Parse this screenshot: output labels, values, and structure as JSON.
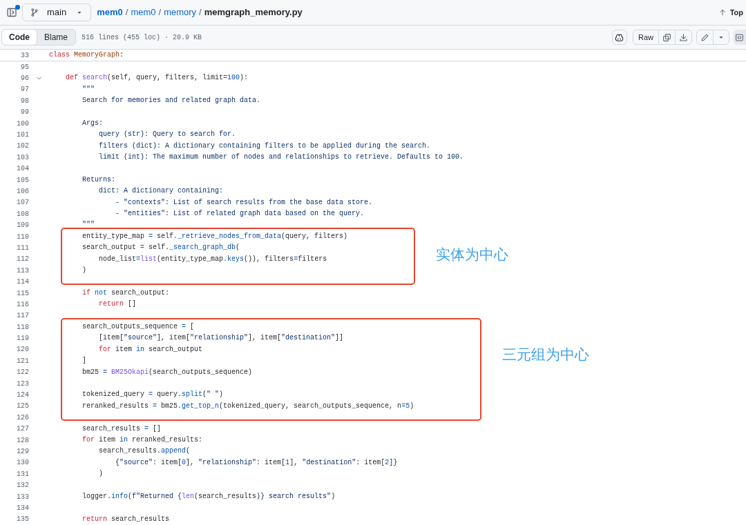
{
  "top_bar": {
    "sidebar_notification": true,
    "branch": "main",
    "breadcrumb": [
      {
        "kind": "repo",
        "text": "mem0"
      },
      {
        "kind": "separator",
        "text": "/"
      },
      {
        "kind": "dir",
        "text": "mem0"
      },
      {
        "kind": "separator",
        "text": "/"
      },
      {
        "kind": "dir",
        "text": "memory"
      },
      {
        "kind": "separator",
        "text": "/"
      },
      {
        "kind": "file",
        "text": "memgraph_memory.py"
      }
    ],
    "top_link": "Top"
  },
  "file_bar": {
    "tabs": [
      {
        "label": "Code",
        "selected": true
      },
      {
        "label": "Blame",
        "selected": false
      }
    ],
    "info": "516 lines (455 loc) · 20.9 KB",
    "raw_label": "Raw"
  },
  "pinned_line": {
    "number": "33",
    "segments": [
      {
        "kind": "keyword",
        "text": "class"
      },
      {
        "kind": "classname",
        "text": " MemoryGraph"
      },
      {
        "kind": "plain",
        "text": ":"
      }
    ]
  },
  "blocks": [
    {
      "kind": "plain",
      "lines": [
        {
          "number": "95"
        },
        {
          "number": "96",
          "expanded": true,
          "segments": [
            {
              "kind": "keyword",
              "text": "    def"
            },
            {
              "kind": "func",
              "text": " search"
            },
            {
              "kind": "plain",
              "text": "(self, query, filters, limit"
            },
            {
              "kind": "operator",
              "text": "="
            },
            {
              "kind": "number",
              "text": "100"
            },
            {
              "kind": "plain",
              "text": "):"
            }
          ]
        },
        {
          "number": "97",
          "segments": [
            {
              "kind": "string",
              "text": "        \"\"\""
            }
          ]
        },
        {
          "number": "98",
          "segments": [
            {
              "kind": "string",
              "text": "        Search for memories and related graph data."
            }
          ]
        },
        {
          "number": "99"
        },
        {
          "number": "100",
          "segments": [
            {
              "kind": "string",
              "text": "        Args:"
            }
          ]
        },
        {
          "number": "101",
          "segments": [
            {
              "kind": "string",
              "text": "            query (str): Query to search for."
            }
          ]
        },
        {
          "number": "102",
          "segments": [
            {
              "kind": "string",
              "text": "            filters (dict): A dictionary containing filters to be applied during the search."
            }
          ]
        },
        {
          "number": "103",
          "segments": [
            {
              "kind": "string",
              "text": "            limit (int): The maximum number of nodes and relationships to retrieve. Defaults to 100."
            }
          ]
        },
        {
          "number": "104"
        },
        {
          "number": "105",
          "segments": [
            {
              "kind": "string",
              "text": "        Returns:"
            }
          ]
        },
        {
          "number": "106",
          "segments": [
            {
              "kind": "string",
              "text": "            dict: A dictionary containing:"
            }
          ]
        },
        {
          "number": "107",
          "segments": [
            {
              "kind": "string",
              "text": "                - \"contexts\": List of search results from the base data store."
            }
          ]
        },
        {
          "number": "108",
          "segments": [
            {
              "kind": "string",
              "text": "                - \"entities\": List of related graph data based on the query."
            }
          ]
        },
        {
          "number": "109",
          "segments": [
            {
              "kind": "string",
              "text": "        \"\"\""
            }
          ]
        }
      ]
    },
    {
      "kind": "highlight",
      "label": "实体为中心",
      "lines": [
        {
          "number": "110",
          "segments": [
            {
              "kind": "plain",
              "text": "        entity_type_map "
            },
            {
              "kind": "operator",
              "text": "="
            },
            {
              "kind": "plain",
              "text": " self."
            },
            {
              "kind": "name",
              "text": "_retrieve_nodes_from_data"
            },
            {
              "kind": "plain",
              "text": "(query, filters)"
            }
          ]
        },
        {
          "number": "111",
          "segments": [
            {
              "kind": "plain",
              "text": "        search_output "
            },
            {
              "kind": "operator",
              "text": "="
            },
            {
              "kind": "plain",
              "text": " self."
            },
            {
              "kind": "name",
              "text": "_search_graph_db"
            },
            {
              "kind": "plain",
              "text": "("
            }
          ]
        },
        {
          "number": "112",
          "segments": [
            {
              "kind": "plain",
              "text": "            node_list"
            },
            {
              "kind": "operator",
              "text": "="
            },
            {
              "kind": "func",
              "text": "list"
            },
            {
              "kind": "plain",
              "text": "(entity_type_map."
            },
            {
              "kind": "name",
              "text": "keys"
            },
            {
              "kind": "plain",
              "text": "()), filters"
            },
            {
              "kind": "operator",
              "text": "="
            },
            {
              "kind": "plain",
              "text": "filters"
            }
          ]
        },
        {
          "number": "113",
          "segments": [
            {
              "kind": "plain",
              "text": "        )"
            }
          ]
        },
        {
          "number": "114"
        }
      ]
    },
    {
      "kind": "plain",
      "lines": [
        {
          "number": "115",
          "segments": [
            {
              "kind": "keyword",
              "text": "        if"
            },
            {
              "kind": "operator",
              "text": " not"
            },
            {
              "kind": "plain",
              "text": " search_output:"
            }
          ]
        },
        {
          "number": "116",
          "segments": [
            {
              "kind": "keyword",
              "text": "            return"
            },
            {
              "kind": "plain",
              "text": " []"
            }
          ]
        },
        {
          "number": "117"
        }
      ]
    },
    {
      "kind": "highlight",
      "label": "三元组为中心",
      "lines": [
        {
          "number": "118",
          "segments": [
            {
              "kind": "plain",
              "text": "        search_outputs_sequence "
            },
            {
              "kind": "operator",
              "text": "="
            },
            {
              "kind": "plain",
              "text": " ["
            }
          ]
        },
        {
          "number": "119",
          "segments": [
            {
              "kind": "plain",
              "text": "            [item["
            },
            {
              "kind": "string",
              "text": "\"source\""
            },
            {
              "kind": "plain",
              "text": "], item["
            },
            {
              "kind": "string",
              "text": "\"relationship\""
            },
            {
              "kind": "plain",
              "text": "], item["
            },
            {
              "kind": "string",
              "text": "\"destination\""
            },
            {
              "kind": "plain",
              "text": "]]"
            }
          ]
        },
        {
          "number": "120",
          "segments": [
            {
              "kind": "keyword",
              "text": "            for"
            },
            {
              "kind": "plain",
              "text": " item "
            },
            {
              "kind": "operator",
              "text": "in"
            },
            {
              "kind": "plain",
              "text": " search_output"
            }
          ]
        },
        {
          "number": "121",
          "segments": [
            {
              "kind": "plain",
              "text": "        ]"
            }
          ]
        },
        {
          "number": "122",
          "segments": [
            {
              "kind": "plain",
              "text": "        bm25 "
            },
            {
              "kind": "operator",
              "text": "="
            },
            {
              "kind": "func",
              "text": " BM25Okapi"
            },
            {
              "kind": "plain",
              "text": "(search_outputs_sequence)"
            }
          ]
        },
        {
          "number": "123"
        },
        {
          "number": "124",
          "segments": [
            {
              "kind": "plain",
              "text": "        tokenized_query "
            },
            {
              "kind": "operator",
              "text": "="
            },
            {
              "kind": "plain",
              "text": " query."
            },
            {
              "kind": "name",
              "text": "split"
            },
            {
              "kind": "plain",
              "text": "("
            },
            {
              "kind": "string",
              "text": "\" \""
            },
            {
              "kind": "plain",
              "text": ")"
            }
          ]
        },
        {
          "number": "125",
          "segments": [
            {
              "kind": "plain",
              "text": "        reranked_results "
            },
            {
              "kind": "operator",
              "text": "="
            },
            {
              "kind": "plain",
              "text": " bm25."
            },
            {
              "kind": "name",
              "text": "get_top_n"
            },
            {
              "kind": "plain",
              "text": "(tokenized_query, search_outputs_sequence, n"
            },
            {
              "kind": "operator",
              "text": "="
            },
            {
              "kind": "number",
              "text": "5"
            },
            {
              "kind": "plain",
              "text": ")"
            }
          ]
        },
        {
          "number": "126"
        }
      ]
    },
    {
      "kind": "plain",
      "lines": [
        {
          "number": "127",
          "segments": [
            {
              "kind": "plain",
              "text": "        search_results "
            },
            {
              "kind": "operator",
              "text": "="
            },
            {
              "kind": "plain",
              "text": " []"
            }
          ]
        },
        {
          "number": "128",
          "segments": [
            {
              "kind": "keyword",
              "text": "        for"
            },
            {
              "kind": "plain",
              "text": " item "
            },
            {
              "kind": "operator",
              "text": "in"
            },
            {
              "kind": "plain",
              "text": " reranked_results:"
            }
          ]
        },
        {
          "number": "129",
          "segments": [
            {
              "kind": "plain",
              "text": "            search_results."
            },
            {
              "kind": "name",
              "text": "append"
            },
            {
              "kind": "plain",
              "text": "("
            }
          ]
        },
        {
          "number": "130",
          "segments": [
            {
              "kind": "plain",
              "text": "                {"
            },
            {
              "kind": "string",
              "text": "\"source\""
            },
            {
              "kind": "plain",
              "text": ": item["
            },
            {
              "kind": "number",
              "text": "0"
            },
            {
              "kind": "plain",
              "text": "], "
            },
            {
              "kind": "string",
              "text": "\"relationship\""
            },
            {
              "kind": "plain",
              "text": ": item["
            },
            {
              "kind": "number",
              "text": "1"
            },
            {
              "kind": "plain",
              "text": "], "
            },
            {
              "kind": "string",
              "text": "\"destination\""
            },
            {
              "kind": "plain",
              "text": ": item["
            },
            {
              "kind": "number",
              "text": "2"
            },
            {
              "kind": "plain",
              "text": "]}"
            }
          ]
        },
        {
          "number": "131",
          "segments": [
            {
              "kind": "plain",
              "text": "            )"
            }
          ]
        },
        {
          "number": "132"
        },
        {
          "number": "133",
          "segments": [
            {
              "kind": "plain",
              "text": "        logger."
            },
            {
              "kind": "name",
              "text": "info"
            },
            {
              "kind": "plain",
              "text": "("
            },
            {
              "kind": "string",
              "text": "f\"Returned {"
            },
            {
              "kind": "func",
              "text": "len"
            },
            {
              "kind": "plain",
              "text": "(search_results)"
            },
            {
              "kind": "string",
              "text": "} search results\""
            },
            {
              "kind": "plain",
              "text": ")"
            }
          ]
        },
        {
          "number": "134"
        },
        {
          "number": "135",
          "segments": [
            {
              "kind": "keyword",
              "text": "        return"
            },
            {
              "kind": "plain",
              "text": " search_results"
            }
          ]
        }
      ]
    }
  ]
}
